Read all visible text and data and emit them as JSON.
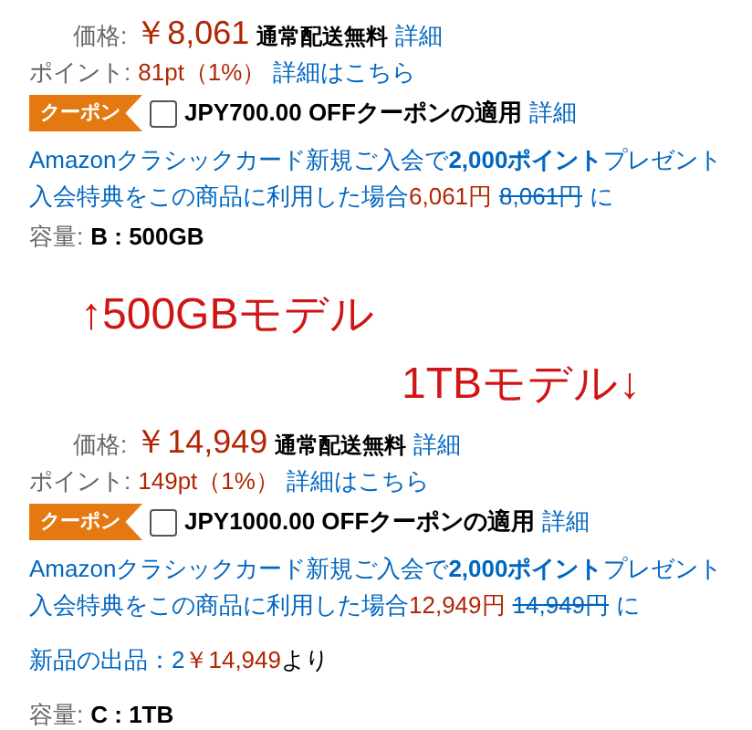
{
  "blocks": [
    {
      "kind": "product",
      "price_label": "価格:",
      "price": "￥8,061",
      "shipping": "通常配送無料",
      "shipping_link": "詳細",
      "points_label": "ポイント:",
      "points": "81pt（1%）",
      "points_link": "詳細はこちら",
      "coupon_badge": "クーポン",
      "coupon_checked": false,
      "coupon_text": "JPY700.00 OFFクーポンの適用",
      "coupon_link": "詳細",
      "card_line1": "Amazonクラシックカード新規ご入会で**2,000ポイント**プレゼント",
      "card_line2": "入会特典をこの商品に利用した場合",
      "card_price": "6,061円",
      "card_old_price": "8,061円",
      "card_suffix": "に",
      "capacity_label": "容量:",
      "capacity": "B : 500GB"
    },
    {
      "kind": "note",
      "text": "↑500GBモデル"
    },
    {
      "kind": "sidenote",
      "text": "1TBモデル↓"
    },
    {
      "kind": "product",
      "price_label": "価格:",
      "price": "￥14,949",
      "shipping": "通常配送無料",
      "shipping_link": "詳細",
      "points_label": "ポイント:",
      "points": "149pt（1%）",
      "points_link": "詳細はこちら",
      "coupon_badge": "クーポン",
      "coupon_checked": false,
      "coupon_text": "JPY1000.00 OFFクーポンの適用",
      "coupon_link": "詳細",
      "card_line1": "Amazonクラシックカード新規ご入会で**2,000ポイント**プレゼント",
      "card_line2": "入会特典をこの商品に利用した場合",
      "card_price": "12,949円",
      "card_old_price": "14,949円",
      "card_suffix": "に",
      "offers": {
        "label": "新品の出品：2",
        "price": "￥14,949",
        "suffix": "より"
      },
      "capacity_label": "容量:",
      "capacity": "C : 1TB"
    }
  ]
}
